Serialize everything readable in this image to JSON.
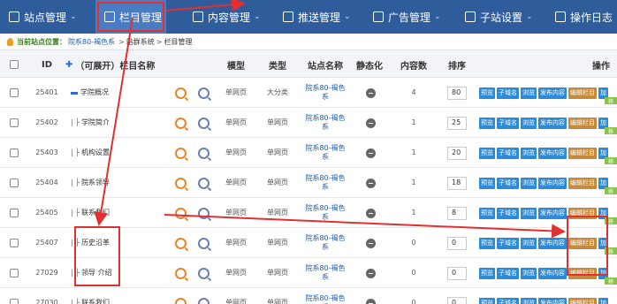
{
  "nav": {
    "items": [
      {
        "label": "站点管理",
        "icon": "sitemap-icon"
      },
      {
        "label": "栏目管理",
        "icon": "list-icon"
      },
      {
        "label": "内容管理",
        "icon": "document-icon"
      },
      {
        "label": "推送管理",
        "icon": "push-icon"
      },
      {
        "label": "广告管理",
        "icon": "ad-icon"
      },
      {
        "label": "子站设置",
        "icon": "monitor-icon"
      },
      {
        "label": "操作日志",
        "icon": "log-icon"
      }
    ]
  },
  "breadcrumb": {
    "label": "当前站点位置：",
    "site": "院系80-褐色系",
    "sep": ">",
    "system": "站群系统",
    "page": "栏目管理"
  },
  "table": {
    "headers": {
      "id": "ID",
      "name": "（可展开）栏目名称",
      "template": "模型",
      "type": "类型",
      "site": "站点名称",
      "static": "静态化",
      "count": "内容数",
      "order": "排序",
      "ops": "操作"
    },
    "rows": [
      {
        "id": "25401",
        "prefix": "",
        "name": "学院概况",
        "template": "单网页",
        "type": "大分类",
        "site": "院系80-褐色系",
        "count": "4",
        "order": "80"
      },
      {
        "id": "25402",
        "prefix": "|  ├",
        "name": "学院简介",
        "template": "单网页",
        "type": "单网页",
        "site": "院系80-褐色系",
        "count": "1",
        "order": "25"
      },
      {
        "id": "25403",
        "prefix": "|  ├",
        "name": "机构设置",
        "template": "单网页",
        "type": "单网页",
        "site": "院系80-褐色系",
        "count": "1",
        "order": "20"
      },
      {
        "id": "25404",
        "prefix": "|  ├",
        "name": "院系领导",
        "template": "单网页",
        "type": "单网页",
        "site": "院系80-褐色系",
        "count": "1",
        "order": "18"
      },
      {
        "id": "25405",
        "prefix": "|  ├",
        "name": "联系我们",
        "template": "单网页",
        "type": "单网页",
        "site": "院系80-褐色系",
        "count": "1",
        "order": "8"
      },
      {
        "id": "25407",
        "prefix": "|  ├",
        "name": "历史沿革",
        "template": "单网页",
        "type": "单网页",
        "site": "院系80-褐色系",
        "count": "0",
        "order": "0"
      },
      {
        "id": "27029",
        "prefix": "|  ├",
        "name": "领导 介绍",
        "template": "单网页",
        "type": "单网页",
        "site": "院系80-褐色系",
        "count": "0",
        "order": "0"
      },
      {
        "id": "27030",
        "prefix": "|  ├",
        "name": "联系我们",
        "template": "单网页",
        "type": "单网页",
        "site": "院系80-褐色系",
        "count": "0",
        "order": "0"
      }
    ],
    "op_labels": {
      "preview": "预览",
      "subdomain": "子域名",
      "browse": "浏览",
      "publish": "发布内容",
      "edit": "编辑栏目",
      "add": "加",
      "mini": "移"
    }
  },
  "colors": {
    "nav_bg": "#2f5d9c",
    "annotation_red": "#e03030",
    "op_blue": "#2d8ad6",
    "op_brown": "#c58a3c"
  }
}
